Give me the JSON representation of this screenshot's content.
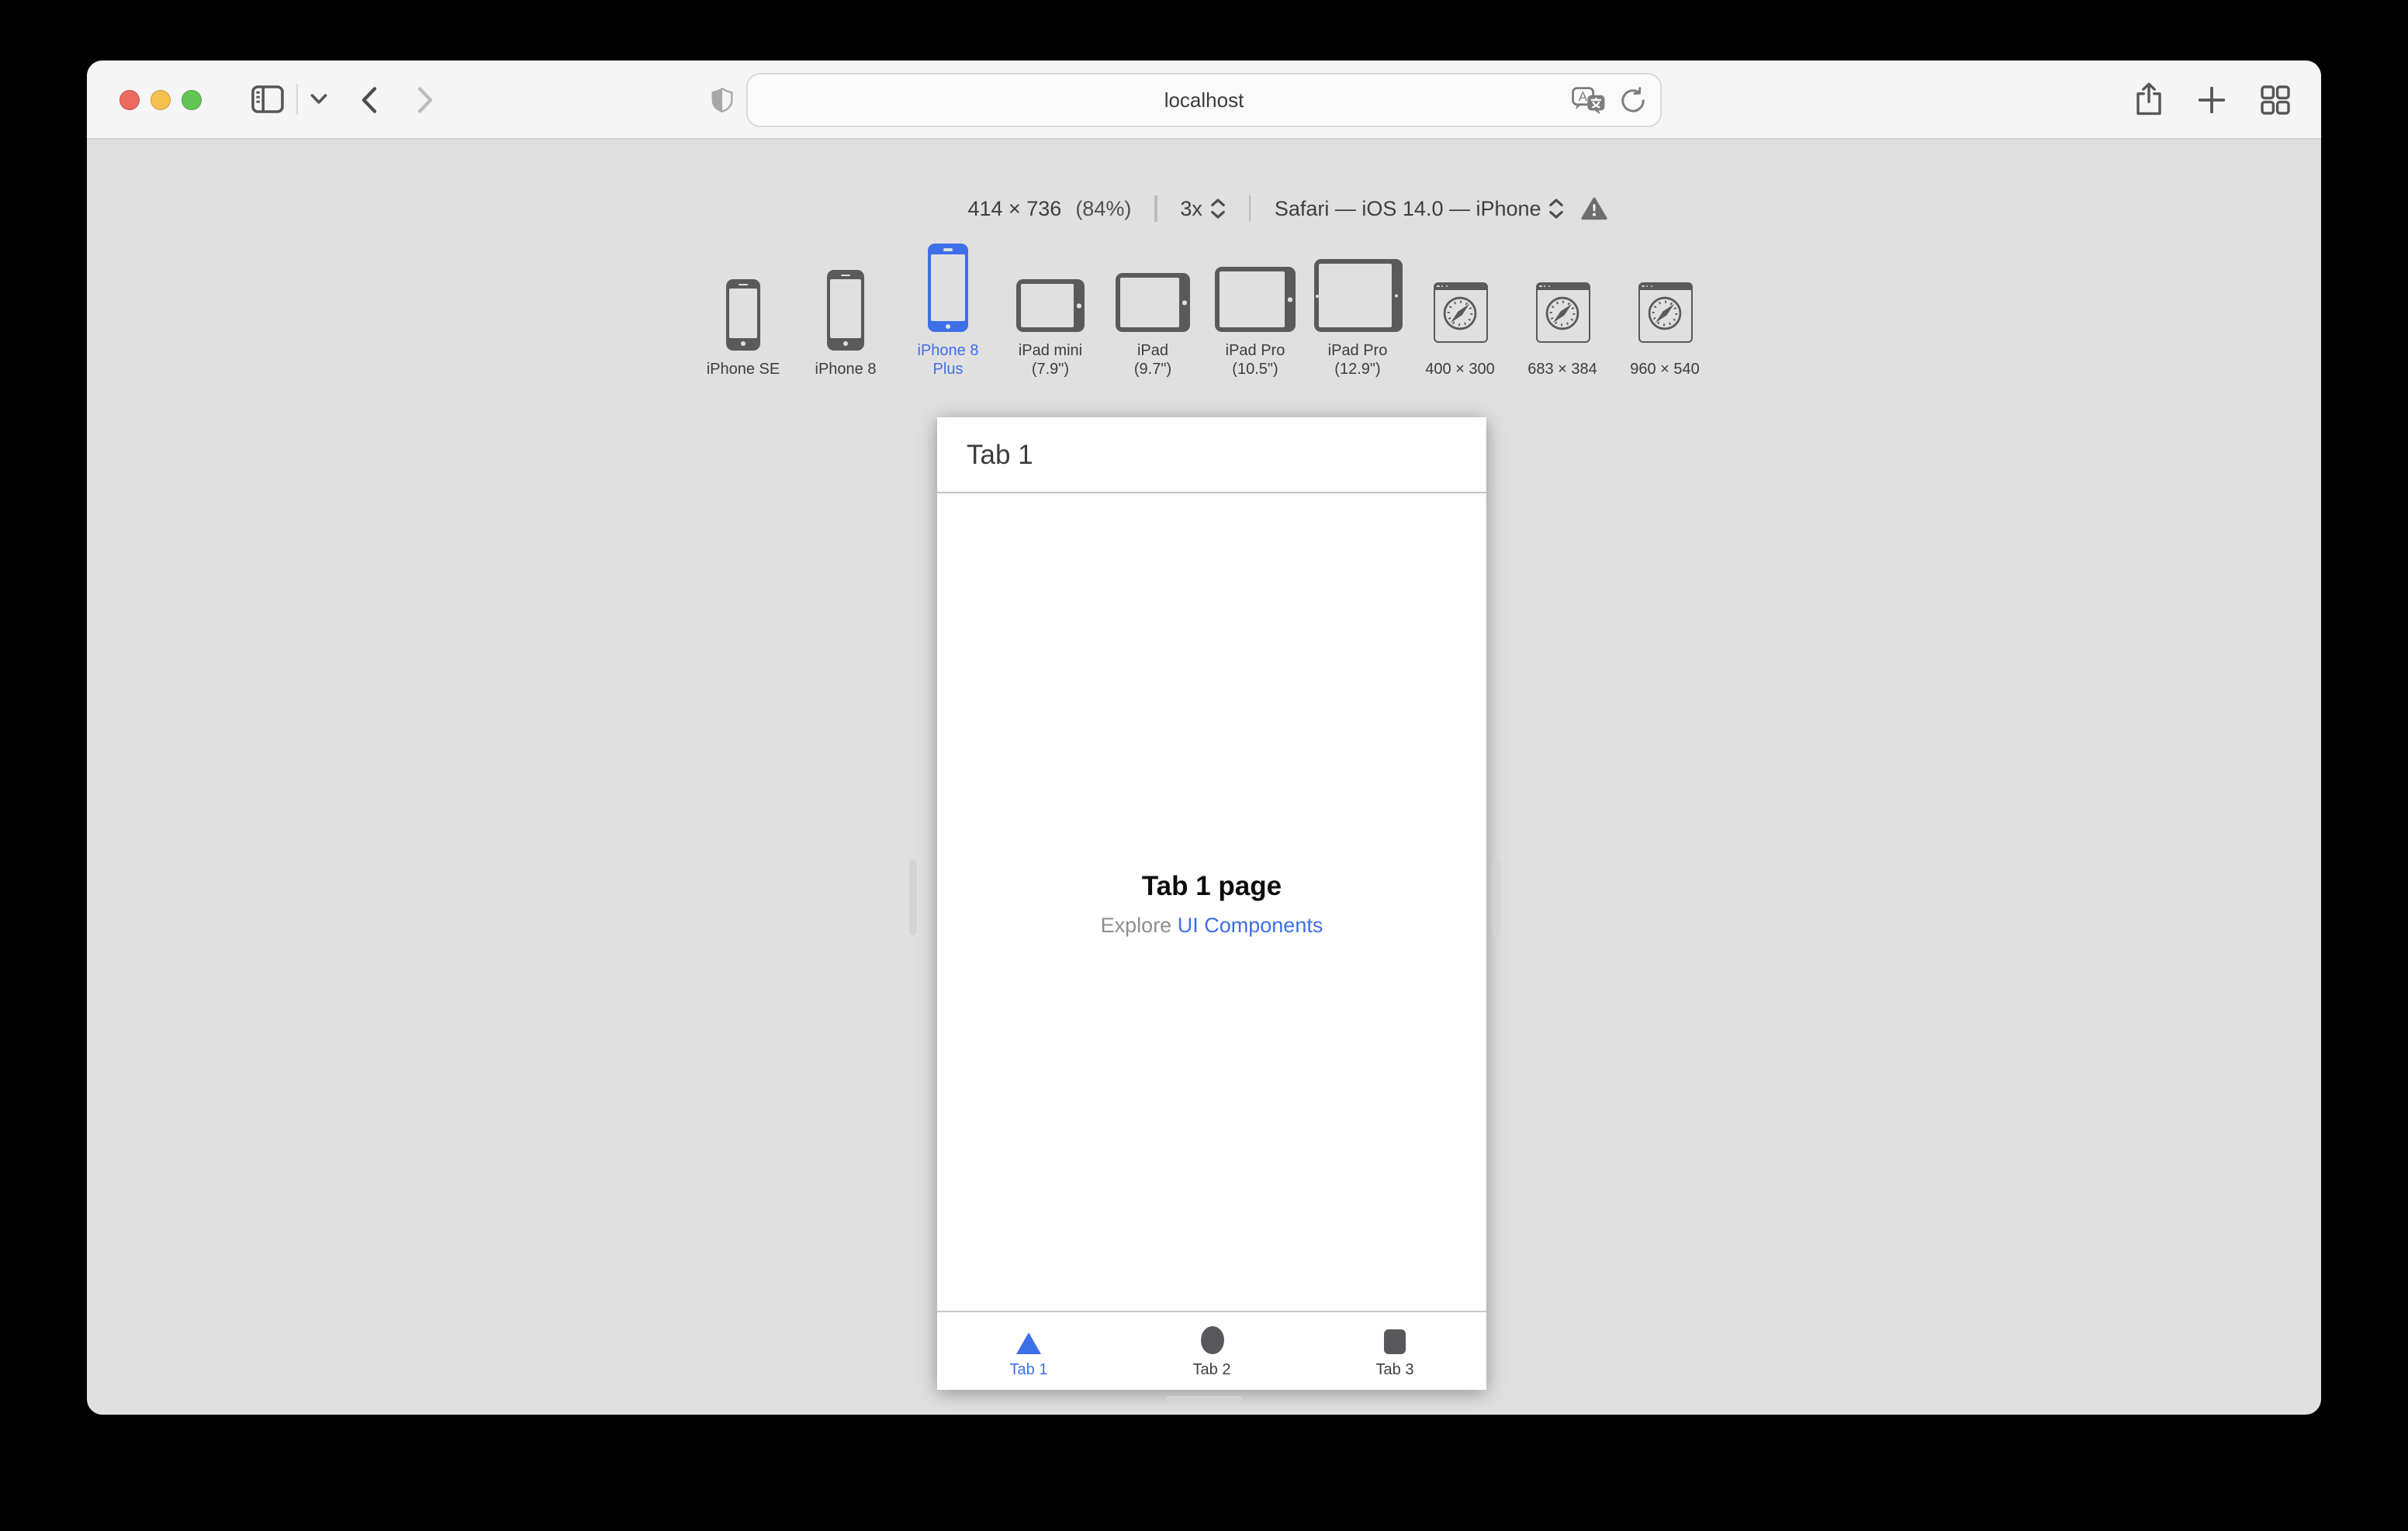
{
  "browser": {
    "traffic_lights": [
      "close",
      "minimize",
      "zoom"
    ],
    "toolbar_icons": [
      "sidebar-icon",
      "chevron-down-icon",
      "back-arrow-icon",
      "forward-arrow-icon",
      "privacy-shield-icon",
      "translate-icon",
      "reload-icon",
      "share-icon",
      "plus-icon",
      "tab-overview-icon"
    ],
    "url": "localhost"
  },
  "responsive_bar": {
    "size_label": "414 × 736",
    "zoom_label": "(84%)",
    "scale_label": "3x",
    "user_agent_label": "Safari — iOS 14.0 — iPhone",
    "warning_icon": "warning-triangle-icon",
    "devices": [
      {
        "line1": "iPhone SE",
        "selected": false
      },
      {
        "line1": "iPhone 8",
        "selected": false
      },
      {
        "line1": "iPhone 8",
        "line2": "Plus",
        "selected": true
      },
      {
        "line1": "iPad mini",
        "line2": "(7.9\")",
        "selected": false
      },
      {
        "line1": "iPad",
        "line2": "(9.7\")",
        "selected": false
      },
      {
        "line1": "iPad Pro",
        "line2": "(10.5\")",
        "selected": false
      },
      {
        "line1": "iPad Pro",
        "line2": "(12.9\")",
        "selected": false
      },
      {
        "line1": "400 × 300",
        "selected": false
      },
      {
        "line1": "683 × 384",
        "selected": false
      },
      {
        "line1": "960 × 540",
        "selected": false
      }
    ]
  },
  "simulated_page": {
    "nav_title": "Tab 1",
    "heading": "Tab 1 page",
    "explore_prefix": "Explore",
    "explore_link": "UI Components",
    "tabs": [
      {
        "label": "Tab 1",
        "icon": "triangle-icon",
        "active": true
      },
      {
        "label": "Tab 2",
        "icon": "circle-icon",
        "active": false
      },
      {
        "label": "Tab 3",
        "icon": "square-icon",
        "active": false
      }
    ]
  },
  "colors": {
    "accent_blue": "#3d6fe8",
    "device_gray": "#5a5a5a",
    "toolbar_bg": "#f6f5f6",
    "canvas_bg": "#e1e0e1",
    "traffic_red": "#ed6a5f",
    "traffic_yellow": "#f5bf4f",
    "traffic_green": "#61c554"
  }
}
